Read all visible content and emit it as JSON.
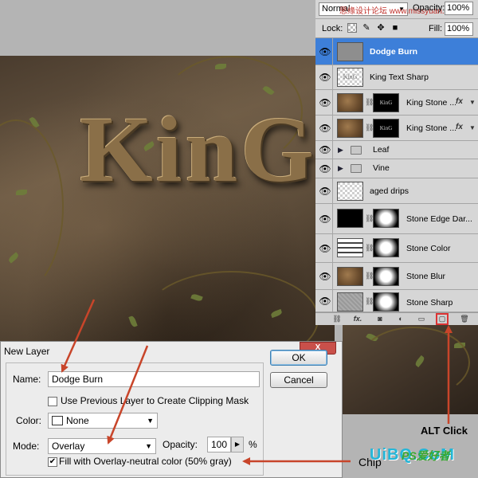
{
  "options_bar": {
    "blend_mode": "Normal",
    "watermark": "思缘设计论坛 www.missyuan.com",
    "opacity_label": "Opacity:",
    "opacity_value": "100%"
  },
  "lock_bar": {
    "lock_label": "Lock:",
    "fill_label": "Fill:",
    "fill_value": "100%"
  },
  "canvas": {
    "artwork_text": "KinG"
  },
  "layers": [
    {
      "name": "Dodge Burn",
      "selected": true
    },
    {
      "name": "King Text Sharp"
    },
    {
      "name": "King Stone ...",
      "fx": "fx"
    },
    {
      "name": "King Stone ...",
      "fx": "fx"
    },
    {
      "name": "Leaf"
    },
    {
      "name": "Vine"
    },
    {
      "name": "aged drips"
    },
    {
      "name": "Stone Edge Dar..."
    },
    {
      "name": "Stone Color"
    },
    {
      "name": "Stone Blur"
    },
    {
      "name": "Stone Sharp"
    }
  ],
  "layers_footer": {
    "fx_label": "fx."
  },
  "dialog": {
    "title": "New Layer",
    "name_label": "Name:",
    "name_value": "Dodge Burn",
    "clip_label": "Use Previous Layer to Create Clipping Mask",
    "color_label": "Color:",
    "color_value": "None",
    "mode_label": "Mode:",
    "mode_value": "Overlay",
    "opacity_label": "Opacity:",
    "opacity_value": "100",
    "opacity_unit": "%",
    "fill_label": "Fill with Overlay-neutral color (50% gray)",
    "ok_label": "OK",
    "cancel_label": "Cancel",
    "close_label": "X"
  },
  "annotations": {
    "alt_click": "ALT Click",
    "chip": "Chip",
    "logo_main": "UiBQ.CoM",
    "logo_ps": "PS爱好者"
  },
  "colors": {
    "selection": "#3d7fd9",
    "arrow": "#c8452a",
    "close_button": "#c9504a"
  }
}
